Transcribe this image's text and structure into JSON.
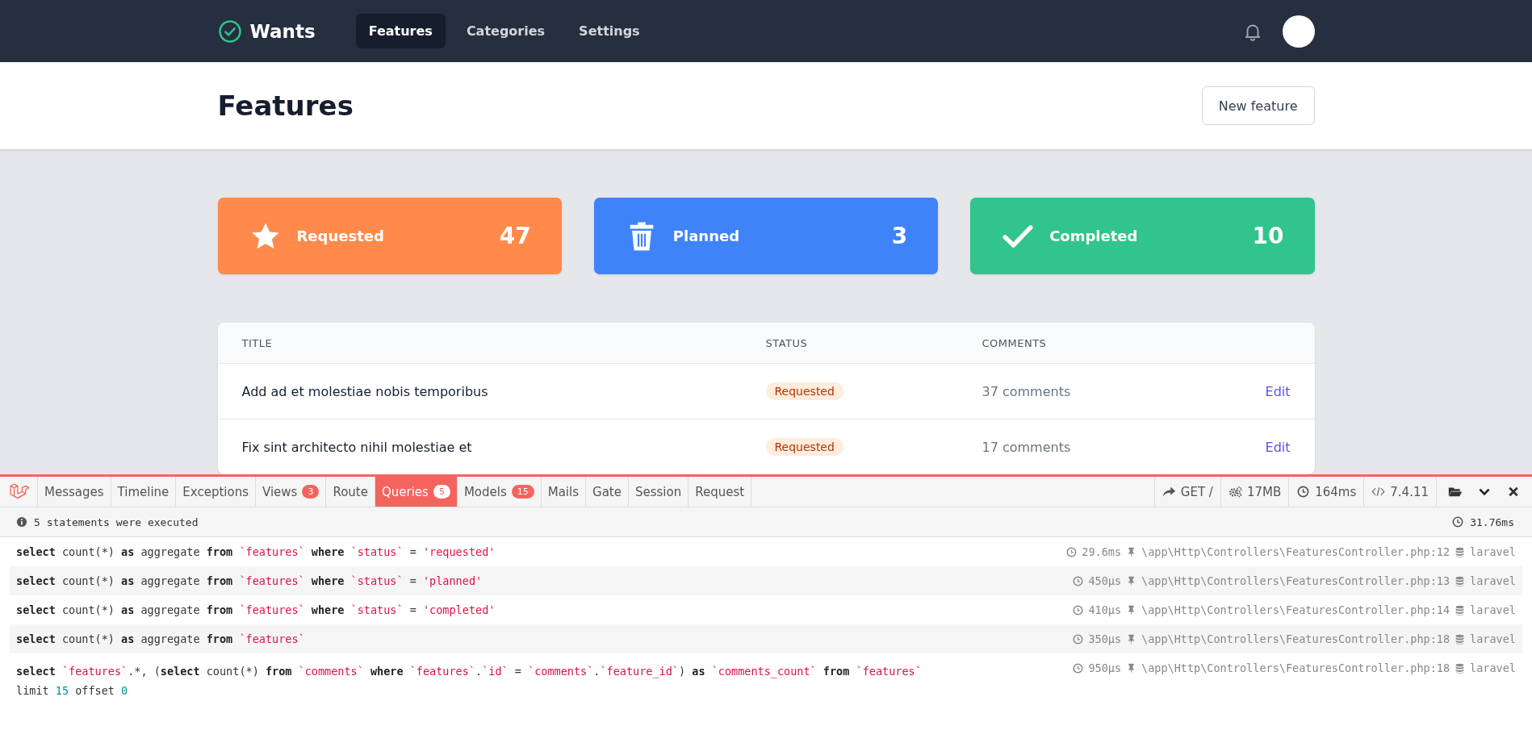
{
  "navbar": {
    "brand": "Wants",
    "links": [
      {
        "label": "Features",
        "selected": true
      },
      {
        "label": "Categories",
        "selected": false
      },
      {
        "label": "Settings",
        "selected": false
      }
    ]
  },
  "header": {
    "title": "Features",
    "button": "New feature"
  },
  "stats": [
    {
      "kind": "star",
      "label": "Requested",
      "count": "47",
      "color": "#ff8a4c"
    },
    {
      "kind": "trash",
      "label": "Planned",
      "count": "3",
      "color": "#3f83f8"
    },
    {
      "kind": "check",
      "label": "Completed",
      "count": "10",
      "color": "#31c48d"
    }
  ],
  "table": {
    "columns": [
      "TITLE",
      "STATUS",
      "COMMENTS"
    ],
    "rows": [
      {
        "title": "Add ad et molestiae nobis temporibus",
        "status": "Requested",
        "comments": "37 comments",
        "action": "Edit"
      },
      {
        "title": "Fix sint architecto nihil molestiae et",
        "status": "Requested",
        "comments": "17 comments",
        "action": "Edit"
      }
    ]
  },
  "debugbar": {
    "tabs": [
      {
        "label": "Messages",
        "selected": false
      },
      {
        "label": "Timeline",
        "selected": false
      },
      {
        "label": "Exceptions",
        "selected": false
      },
      {
        "label": "Views",
        "badge": "3",
        "selected": false
      },
      {
        "label": "Route",
        "selected": false
      },
      {
        "label": "Queries",
        "badge": "5",
        "selected": true
      },
      {
        "label": "Models",
        "badge": "15",
        "selected": false
      },
      {
        "label": "Mails",
        "selected": false
      },
      {
        "label": "Gate",
        "selected": false
      },
      {
        "label": "Session",
        "selected": false
      },
      {
        "label": "Request",
        "selected": false
      }
    ],
    "request": "GET /",
    "memory": "17MB",
    "duration": "164ms",
    "php_version": "7.4.11",
    "summary": "5 statements were executed",
    "total_time": "31.76ms",
    "queries": [
      {
        "lines": [
          [
            {
              "kind": "keyword",
              "text": "select"
            },
            {
              "kind": "plain",
              "text": " count(*) "
            },
            {
              "kind": "keyword",
              "text": "as"
            },
            {
              "kind": "plain",
              "text": " aggregate "
            },
            {
              "kind": "keyword",
              "text": "from "
            },
            {
              "kind": "string",
              "text": "`features`"
            },
            {
              "kind": "keyword",
              "text": " where "
            },
            {
              "kind": "string",
              "text": "`status`"
            },
            {
              "kind": "plain",
              "text": " = "
            },
            {
              "kind": "string",
              "text": "'requested'"
            }
          ]
        ],
        "time": "29.6ms",
        "source": "\\app\\Http\\Controllers\\FeaturesController.php:12",
        "connection": "laravel"
      },
      {
        "lines": [
          [
            {
              "kind": "keyword",
              "text": "select"
            },
            {
              "kind": "plain",
              "text": " count(*) "
            },
            {
              "kind": "keyword",
              "text": "as"
            },
            {
              "kind": "plain",
              "text": " aggregate "
            },
            {
              "kind": "keyword",
              "text": "from "
            },
            {
              "kind": "string",
              "text": "`features`"
            },
            {
              "kind": "keyword",
              "text": " where "
            },
            {
              "kind": "string",
              "text": "`status`"
            },
            {
              "kind": "plain",
              "text": " = "
            },
            {
              "kind": "string",
              "text": "'planned'"
            }
          ]
        ],
        "time": "450μs",
        "source": "\\app\\Http\\Controllers\\FeaturesController.php:13",
        "connection": "laravel"
      },
      {
        "lines": [
          [
            {
              "kind": "keyword",
              "text": "select"
            },
            {
              "kind": "plain",
              "text": " count(*) "
            },
            {
              "kind": "keyword",
              "text": "as"
            },
            {
              "kind": "plain",
              "text": " aggregate "
            },
            {
              "kind": "keyword",
              "text": "from "
            },
            {
              "kind": "string",
              "text": "`features`"
            },
            {
              "kind": "keyword",
              "text": " where "
            },
            {
              "kind": "string",
              "text": "`status`"
            },
            {
              "kind": "plain",
              "text": " = "
            },
            {
              "kind": "string",
              "text": "'completed'"
            }
          ]
        ],
        "time": "410μs",
        "source": "\\app\\Http\\Controllers\\FeaturesController.php:14",
        "connection": "laravel"
      },
      {
        "lines": [
          [
            {
              "kind": "keyword",
              "text": "select"
            },
            {
              "kind": "plain",
              "text": " count(*) "
            },
            {
              "kind": "keyword",
              "text": "as"
            },
            {
              "kind": "plain",
              "text": " aggregate "
            },
            {
              "kind": "keyword",
              "text": "from "
            },
            {
              "kind": "string",
              "text": "`features`"
            }
          ]
        ],
        "time": "350μs",
        "source": "\\app\\Http\\Controllers\\FeaturesController.php:18",
        "connection": "laravel"
      },
      {
        "lines": [
          [
            {
              "kind": "keyword",
              "text": "select "
            },
            {
              "kind": "string",
              "text": "`features`"
            },
            {
              "kind": "plain",
              "text": ".*, ("
            },
            {
              "kind": "keyword",
              "text": "select"
            },
            {
              "kind": "plain",
              "text": " count(*) "
            },
            {
              "kind": "keyword",
              "text": "from "
            },
            {
              "kind": "string",
              "text": "`comments`"
            },
            {
              "kind": "keyword",
              "text": " where "
            },
            {
              "kind": "string",
              "text": "`features`"
            },
            {
              "kind": "plain",
              "text": "."
            },
            {
              "kind": "string",
              "text": "`id`"
            },
            {
              "kind": "plain",
              "text": " = "
            },
            {
              "kind": "string",
              "text": "`comments`"
            },
            {
              "kind": "plain",
              "text": "."
            },
            {
              "kind": "string",
              "text": "`feature_id`"
            },
            {
              "kind": "plain",
              "text": ") "
            },
            {
              "kind": "keyword",
              "text": "as "
            },
            {
              "kind": "string",
              "text": "`comments_count`"
            },
            {
              "kind": "keyword",
              "text": " from "
            },
            {
              "kind": "string",
              "text": "`features`"
            }
          ],
          [
            {
              "kind": "plain",
              "text": "limit "
            },
            {
              "kind": "number",
              "text": "15"
            },
            {
              "kind": "plain",
              "text": " offset "
            },
            {
              "kind": "number",
              "text": "0"
            }
          ]
        ],
        "time": "950μs",
        "source": "\\app\\Http\\Controllers\\FeaturesController.php:18",
        "connection": "laravel"
      }
    ]
  }
}
